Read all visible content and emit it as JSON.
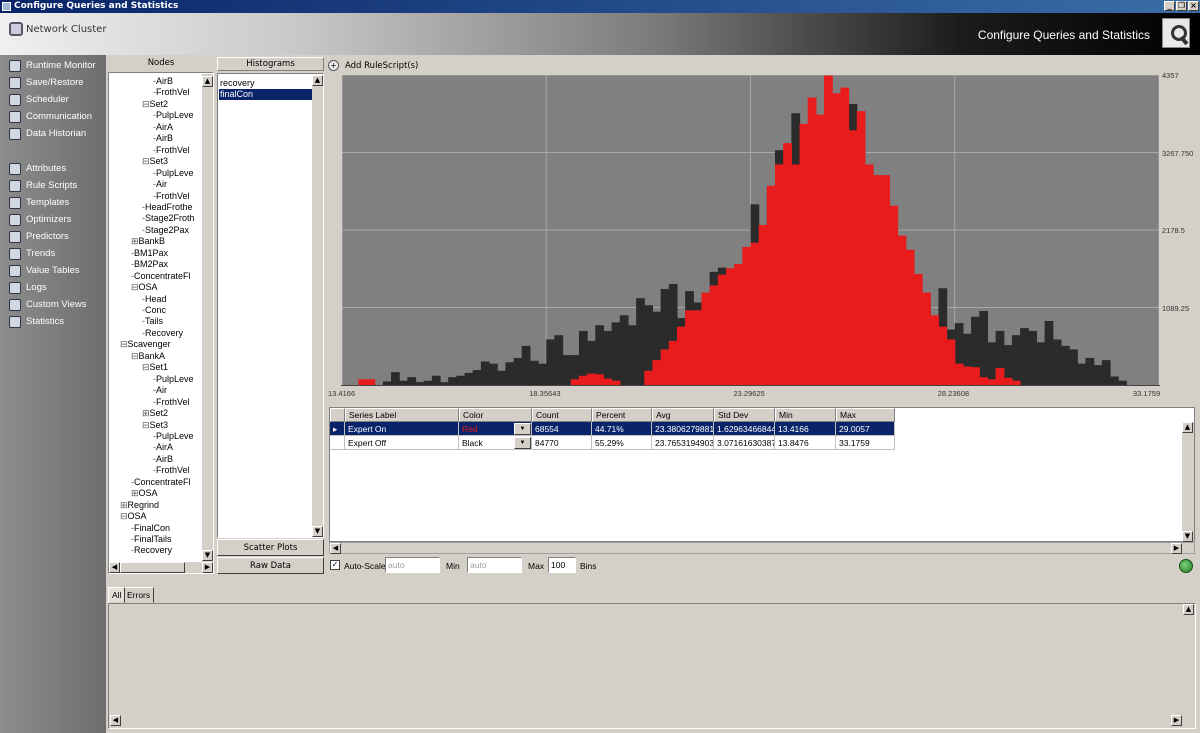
{
  "window": {
    "title": "Configure Queries and Statistics"
  },
  "header": {
    "cluster_label": "Network Cluster",
    "page_title": "Configure Queries and Statistics"
  },
  "sidebar": {
    "items": [
      {
        "label": "Runtime Monitor",
        "icon": "monitor-icon"
      },
      {
        "label": "Save/Restore",
        "icon": "save-icon"
      },
      {
        "label": "Scheduler",
        "icon": "scheduler-icon"
      },
      {
        "label": "Communication",
        "icon": "globe-icon"
      },
      {
        "label": "Data Historian",
        "icon": "database-icon"
      },
      {
        "label": "Attributes",
        "icon": "attributes-icon"
      },
      {
        "label": "Rule Scripts",
        "icon": "script-icon"
      },
      {
        "label": "Templates",
        "icon": "template-icon"
      },
      {
        "label": "Optimizers",
        "icon": "optimizer-icon"
      },
      {
        "label": "Predictors",
        "icon": "predictor-icon"
      },
      {
        "label": "Trends",
        "icon": "trends-icon"
      },
      {
        "label": "Value Tables",
        "icon": "table-icon"
      },
      {
        "label": "Logs",
        "icon": "logs-icon"
      },
      {
        "label": "Custom Views",
        "icon": "views-icon"
      },
      {
        "label": "Statistics",
        "icon": "statistics-icon"
      }
    ]
  },
  "nodes": {
    "title": "Nodes",
    "items": [
      {
        "label": "AirB",
        "depth": 3,
        "prefix": "-"
      },
      {
        "label": "FrothVel",
        "depth": 3,
        "prefix": "-"
      },
      {
        "label": "Set2",
        "depth": 2,
        "prefix": "⊟"
      },
      {
        "label": "PulpLeve",
        "depth": 3,
        "prefix": "-"
      },
      {
        "label": "AirA",
        "depth": 3,
        "prefix": "-"
      },
      {
        "label": "AirB",
        "depth": 3,
        "prefix": "-"
      },
      {
        "label": "FrothVel",
        "depth": 3,
        "prefix": "-"
      },
      {
        "label": "Set3",
        "depth": 2,
        "prefix": "⊟"
      },
      {
        "label": "PulpLeve",
        "depth": 3,
        "prefix": "-"
      },
      {
        "label": "Air",
        "depth": 3,
        "prefix": "-"
      },
      {
        "label": "FrothVel",
        "depth": 3,
        "prefix": "-"
      },
      {
        "label": "HeadFrothe",
        "depth": 2,
        "prefix": "-"
      },
      {
        "label": "Stage2Froth",
        "depth": 2,
        "prefix": "-"
      },
      {
        "label": "Stage2Pax",
        "depth": 2,
        "prefix": "-"
      },
      {
        "label": "BankB",
        "depth": 1,
        "prefix": "⊞"
      },
      {
        "label": "BM1Pax",
        "depth": 1,
        "prefix": "-"
      },
      {
        "label": "BM2Pax",
        "depth": 1,
        "prefix": "-"
      },
      {
        "label": "ConcentrateFl",
        "depth": 1,
        "prefix": "-"
      },
      {
        "label": "OSA",
        "depth": 1,
        "prefix": "⊟"
      },
      {
        "label": "Head",
        "depth": 2,
        "prefix": "-"
      },
      {
        "label": "Conc",
        "depth": 2,
        "prefix": "-"
      },
      {
        "label": "Tails",
        "depth": 2,
        "prefix": "-"
      },
      {
        "label": "Recovery",
        "depth": 2,
        "prefix": "-"
      },
      {
        "label": "Scavenger",
        "depth": 0,
        "prefix": "⊟"
      },
      {
        "label": "BankA",
        "depth": 1,
        "prefix": "⊟"
      },
      {
        "label": "Set1",
        "depth": 2,
        "prefix": "⊟"
      },
      {
        "label": "PulpLeve",
        "depth": 3,
        "prefix": "-"
      },
      {
        "label": "Air",
        "depth": 3,
        "prefix": "-"
      },
      {
        "label": "FrothVel",
        "depth": 3,
        "prefix": "-"
      },
      {
        "label": "Set2",
        "depth": 2,
        "prefix": "⊞"
      },
      {
        "label": "Set3",
        "depth": 2,
        "prefix": "⊟"
      },
      {
        "label": "PulpLeve",
        "depth": 3,
        "prefix": "-"
      },
      {
        "label": "AirA",
        "depth": 3,
        "prefix": "-"
      },
      {
        "label": "AirB",
        "depth": 3,
        "prefix": "-"
      },
      {
        "label": "FrothVel",
        "depth": 3,
        "prefix": "-"
      },
      {
        "label": "ConcentrateFl",
        "depth": 1,
        "prefix": "-"
      },
      {
        "label": "OSA",
        "depth": 1,
        "prefix": "⊞"
      },
      {
        "label": "Regrind",
        "depth": 0,
        "prefix": "⊞"
      },
      {
        "label": "OSA",
        "depth": 0,
        "prefix": "⊟"
      },
      {
        "label": "FinalCon",
        "depth": 1,
        "prefix": "-"
      },
      {
        "label": "FinalTails",
        "depth": 1,
        "prefix": "-"
      },
      {
        "label": "Recovery",
        "depth": 1,
        "prefix": "-"
      }
    ]
  },
  "histograms": {
    "title": "Histograms",
    "items": [
      {
        "label": "recovery",
        "selected": false
      },
      {
        "label": "finalCon",
        "selected": true
      }
    ]
  },
  "buttons": {
    "scatter_plots": "Scatter Plots",
    "raw_data": "Raw Data",
    "add_rulescript": "Add RuleScript(s)"
  },
  "chart_data": {
    "type": "bar",
    "x_ticks": [
      "13.4166",
      "18.35643",
      "23.29625",
      "28.23608",
      "33.1759"
    ],
    "y_ticks": [
      "4357",
      "3267.750",
      "2178.5",
      "1089.25"
    ],
    "xlim": [
      13.4166,
      33.1759
    ],
    "ylim": [
      0,
      4357
    ],
    "grid": true,
    "bins": 100,
    "series": [
      {
        "name": "Expert Off",
        "color": "#2b2b2b",
        "values": [
          0,
          0,
          0,
          0,
          0,
          50,
          180,
          60,
          110,
          40,
          60,
          130,
          40,
          110,
          130,
          170,
          210,
          330,
          300,
          200,
          320,
          380,
          550,
          340,
          300,
          640,
          700,
          420,
          420,
          760,
          620,
          840,
          760,
          880,
          980,
          840,
          1220,
          1120,
          1030,
          1350,
          1420,
          940,
          1320,
          1160,
          1100,
          1590,
          1650,
          1310,
          1440,
          1530,
          2540,
          2110,
          2700,
          3300,
          3060,
          3820,
          2940,
          3700,
          3550,
          3320,
          4000,
          3100,
          3950,
          3300,
          2800,
          2400,
          2500,
          2100,
          1520,
          1750,
          1020,
          1140,
          920,
          1360,
          780,
          870,
          720,
          960,
          1040,
          600,
          760,
          560,
          700,
          800,
          760,
          600,
          900,
          640,
          550,
          500,
          300,
          380,
          280,
          350,
          120,
          60,
          0,
          0,
          0,
          0
        ]
      },
      {
        "name": "Expert On",
        "color": "#e81c1c",
        "values": [
          0,
          0,
          80,
          80,
          0,
          0,
          0,
          0,
          0,
          0,
          0,
          0,
          0,
          0,
          0,
          0,
          0,
          0,
          0,
          0,
          0,
          0,
          0,
          0,
          0,
          0,
          0,
          0,
          80,
          130,
          160,
          150,
          90,
          60,
          0,
          0,
          0,
          200,
          350,
          500,
          620,
          820,
          1050,
          1050,
          1300,
          1400,
          1550,
          1640,
          1700,
          1940,
          2000,
          2250,
          2800,
          3100,
          3400,
          3100,
          3670,
          4040,
          3800,
          4350,
          4100,
          4180,
          3580,
          3850,
          3100,
          2950,
          2950,
          2520,
          2100,
          1900,
          1560,
          1300,
          980,
          820,
          640,
          300,
          260,
          250,
          110,
          80,
          240,
          100,
          60,
          0,
          0,
          0,
          0,
          0,
          0,
          0,
          0,
          0,
          0,
          0,
          0,
          0,
          0,
          0,
          0,
          0
        ]
      }
    ]
  },
  "table": {
    "columns": [
      "Series Label",
      "Color",
      "Count",
      "Percent",
      "Avg",
      "Std Dev",
      "Min",
      "Max"
    ],
    "rows": [
      {
        "series_label": "Expert On",
        "color": "Red",
        "count": "68554",
        "percent": "44.71%",
        "avg": "23.38062798815",
        "std_dev": "1.629634668446",
        "min": "13.4166",
        "max": "29.0057",
        "selected": true
      },
      {
        "series_label": "Expert Off",
        "color": "Black",
        "count": "84770",
        "percent": "55.29%",
        "avg": "23.76531949038",
        "std_dev": "3.071616303875",
        "min": "13.8476",
        "max": "33.1759",
        "selected": false
      }
    ]
  },
  "options": {
    "auto_scale_label": "Auto-Scale",
    "auto_scale_checked": true,
    "scale_value": "auto",
    "min_label": "Min",
    "min_value": "auto",
    "max_label": "Max",
    "max_value": "100",
    "bins_label": "Bins"
  },
  "log": {
    "tabs": [
      "All",
      "Errors"
    ],
    "active_tab": "All"
  }
}
